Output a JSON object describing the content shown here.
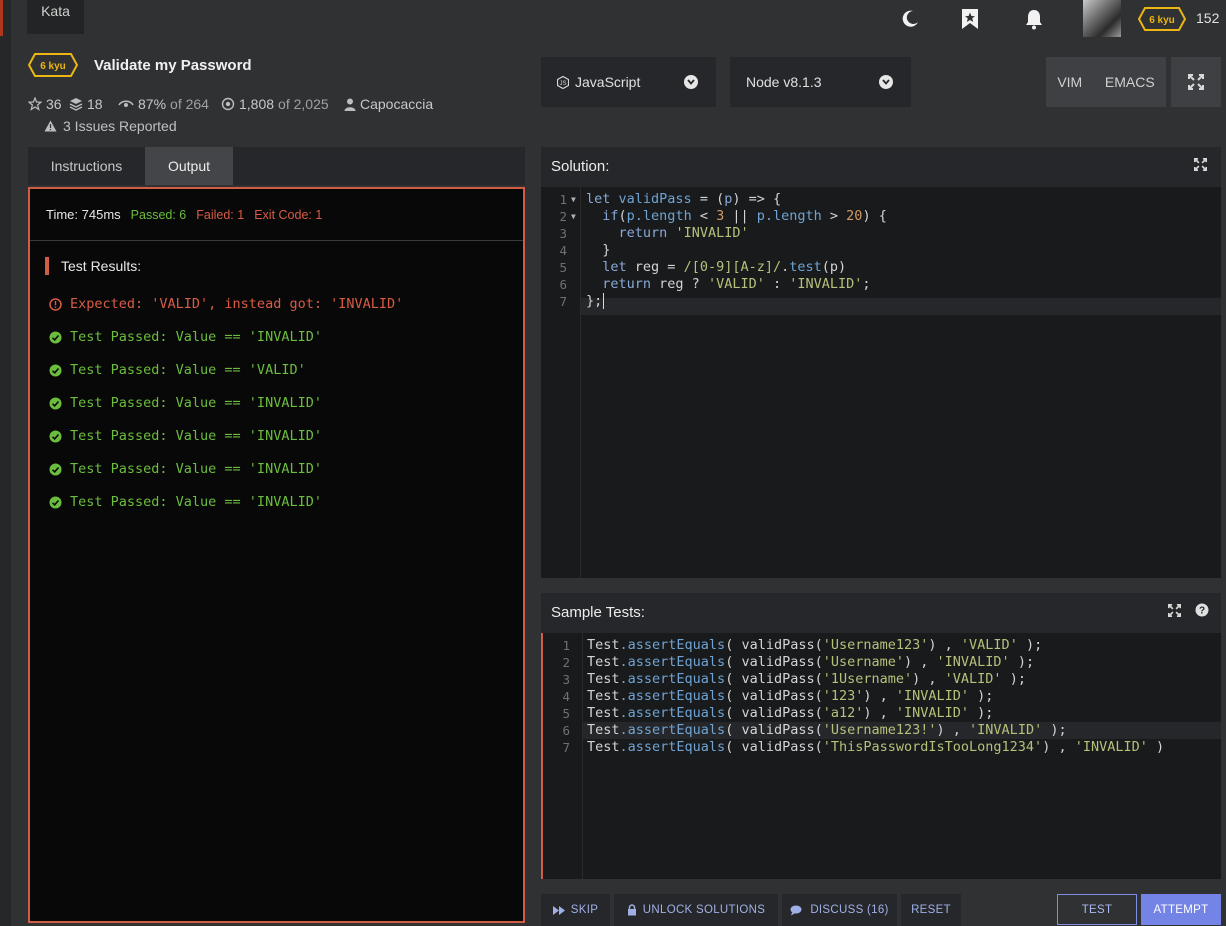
{
  "nav": {
    "kata_tab": "Kata",
    "rank_badge": "6 kyu",
    "honor": "152"
  },
  "kata": {
    "rank": "6 kyu",
    "title": "Validate my Password",
    "stars": "36",
    "collections": "18",
    "satisfaction": "87%",
    "satisfaction_of": "of 264",
    "completed": "1,808",
    "completed_of": "of 2,025",
    "author": "Capocaccia",
    "issues": "3 Issues Reported"
  },
  "editor_settings": {
    "language": "JavaScript",
    "version": "Node v8.1.3",
    "vim_label": "VIM",
    "emacs_label": "EMACS"
  },
  "left_tabs": {
    "instructions": "Instructions",
    "output": "Output"
  },
  "output": {
    "time": "Time: 745ms",
    "passed": "Passed: 6",
    "failed": "Failed: 1",
    "exit_code": "Exit Code: 1",
    "results_heading": "Test Results:",
    "results": [
      {
        "status": "fail",
        "text": "Expected: 'VALID', instead got: 'INVALID'"
      },
      {
        "status": "pass",
        "text": "Test Passed: Value == 'INVALID'"
      },
      {
        "status": "pass",
        "text": "Test Passed: Value == 'VALID'"
      },
      {
        "status": "pass",
        "text": "Test Passed: Value == 'INVALID'"
      },
      {
        "status": "pass",
        "text": "Test Passed: Value == 'INVALID'"
      },
      {
        "status": "pass",
        "text": "Test Passed: Value == 'INVALID'"
      },
      {
        "status": "pass",
        "text": "Test Passed: Value == 'INVALID'"
      }
    ]
  },
  "solution": {
    "heading": "Solution:",
    "line_numbers": [
      "1",
      "2",
      "3",
      "4",
      "5",
      "6",
      "7"
    ]
  },
  "tests": {
    "heading": "Sample Tests:",
    "line_numbers": [
      "1",
      "2",
      "3",
      "4",
      "5",
      "6",
      "7"
    ],
    "obj": "Test",
    "method": ".assertEquals",
    "calls": [
      {
        "arg": "'Username123'",
        "expected": "'VALID'",
        "end": " );"
      },
      {
        "arg": "'Username'",
        "expected": "'INVALID'",
        "end": " );"
      },
      {
        "arg": "'1Username'",
        "expected": "'VALID'",
        "end": " );"
      },
      {
        "arg": "'123'",
        "expected": "'INVALID'",
        "end": " );"
      },
      {
        "arg": "'a12'",
        "expected": "'INVALID'",
        "end": " );"
      },
      {
        "arg": "'Username123!'",
        "expected": "'INVALID'",
        "end": " );"
      },
      {
        "arg": "'ThisPasswordIsTooLong1234'",
        "expected": "'INVALID'",
        "end": " )"
      }
    ]
  },
  "actions": {
    "skip": "SKIP",
    "unlock": "UNLOCK SOLUTIONS",
    "discuss": "DISCUSS (16)",
    "reset": "RESET",
    "test": "TEST",
    "attempt": "ATTEMPT"
  },
  "icons": {
    "dark_mode": "moon-icon",
    "bookmarks": "bookmark-star-icon",
    "notifications": "bell-icon",
    "fullscreen": "expand-icon",
    "help": "help-icon"
  },
  "colors": {
    "accent_red": "#d05e45",
    "pass_green": "#6bbd3e",
    "rank_yellow": "#ecb613",
    "attempt_blue": "#7383e6"
  }
}
